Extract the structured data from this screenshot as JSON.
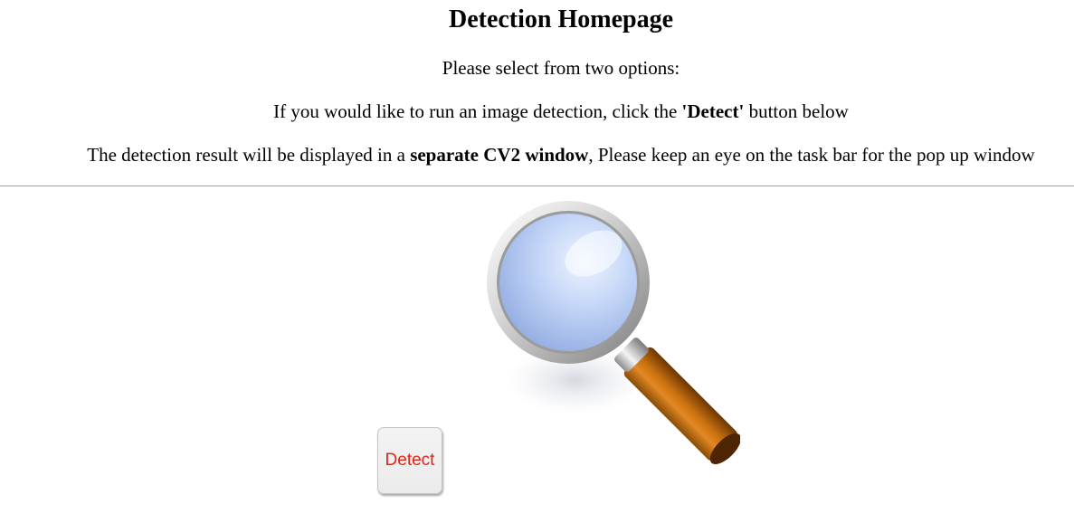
{
  "page": {
    "title": "Detection Homepage",
    "line1": "Please select from two options:",
    "line2": {
      "before": "If you would like to run an image detection, click the ",
      "bold": "'Detect'",
      "after": " button below"
    },
    "line3": {
      "before": "The detection result will be displayed in a ",
      "bold": "separate CV2 window",
      "after": ", Please keep an eye on the task bar for the pop up window"
    }
  },
  "image": {
    "icon": "magnifying-glass-icon"
  },
  "detect_button": {
    "label": "Detect",
    "text_color": "#e2231a"
  }
}
